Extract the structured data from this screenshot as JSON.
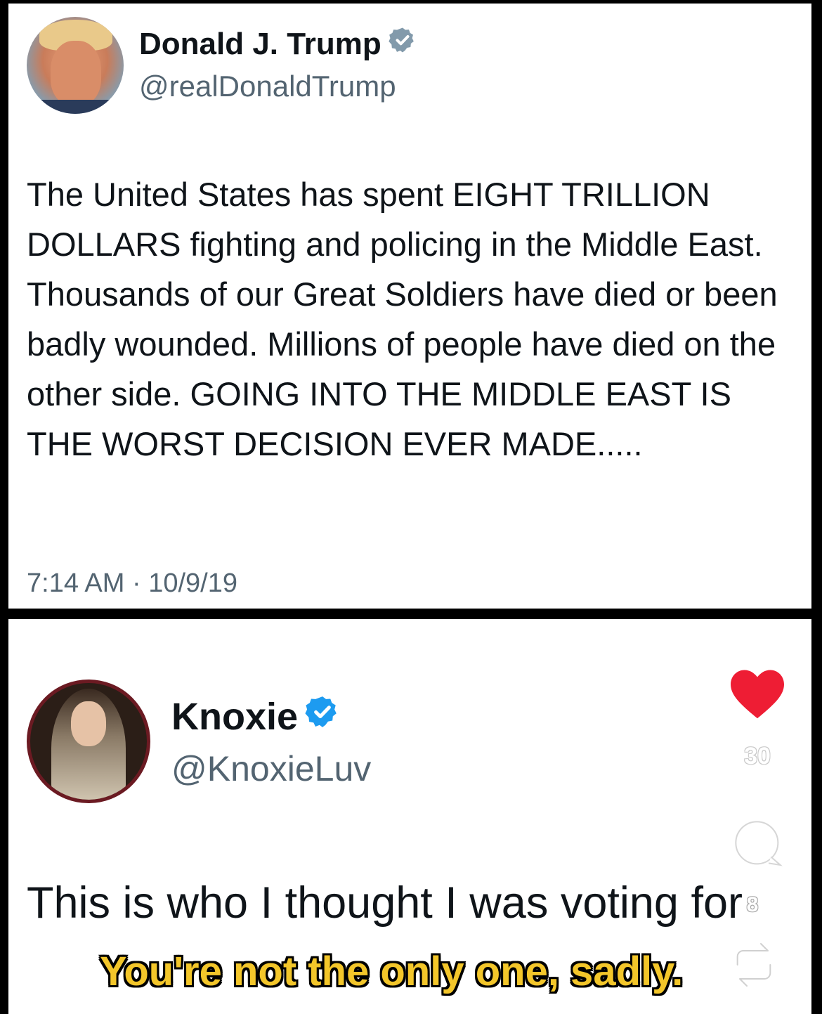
{
  "top_post": {
    "display_name": "Donald J. Trump",
    "handle": "@realDonaldTrump",
    "body": "The United States has spent EIGHT TRILLION DOLLARS fighting and policing in the Middle East. Thousands of our Great Soldiers have died or been badly wounded. Millions of people have died on the other side. GOING INTO THE MIDDLE EAST IS THE WORST DECISION EVER MADE.....",
    "timestamp": "7:14 AM · 10/9/19",
    "verified_badge_color": "#829aab"
  },
  "bottom_post": {
    "display_name": "Knoxie",
    "handle": "@KnoxieLuv",
    "body": "This is who I thought I was voting for",
    "verified_badge_color": "#1d9bf0"
  },
  "caption": "You're not the only one, sadly.",
  "side_actions": {
    "like_icon": "heart-icon",
    "like_count": "30",
    "like_color": "#ee1d34",
    "comment_icon": "comment-icon",
    "comment_count": "8",
    "share_icon": "share-icon"
  }
}
